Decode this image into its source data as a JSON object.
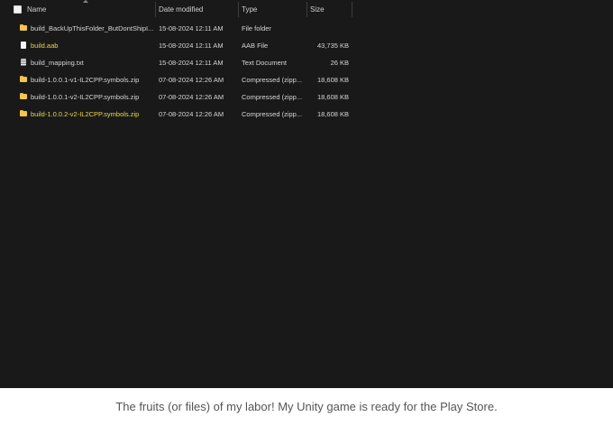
{
  "columns": {
    "name": "Name",
    "date_modified": "Date modified",
    "type": "Type",
    "size": "Size"
  },
  "files": [
    {
      "name": "build_BackUpThisFolder_ButDontShipI...",
      "date": "15-08-2024 12:11 AM",
      "type": "File folder",
      "size": "",
      "icon": "folder-icon",
      "highlight": false
    },
    {
      "name": "build.aab",
      "date": "15-08-2024 12:11 AM",
      "type": "AAB File",
      "size": "43,735 KB",
      "icon": "file-icon",
      "highlight": true
    },
    {
      "name": "build_mapping.txt",
      "date": "15-08-2024 12:11 AM",
      "type": "Text Document",
      "size": "26 KB",
      "icon": "text-document-icon",
      "highlight": false
    },
    {
      "name": "build-1.0.0.1-v1-IL2CPP.symbols.zip",
      "date": "07-08-2024 12:26 AM",
      "type": "Compressed (zipp...",
      "size": "18,608 KB",
      "icon": "zip-folder-icon",
      "highlight": false
    },
    {
      "name": "build-1.0.0.1-v2-IL2CPP.symbols.zip",
      "date": "07-08-2024 12:26 AM",
      "type": "Compressed (zipp...",
      "size": "18,608 KB",
      "icon": "zip-folder-icon",
      "highlight": false
    },
    {
      "name": "build-1.0.0.2-v2-IL2CPP.symbols.zip",
      "date": "07-08-2024 12:26 AM",
      "type": "Compressed (zipp...",
      "size": "18,608 KB",
      "icon": "zip-folder-icon",
      "highlight": true
    }
  ],
  "caption": "The fruits (or files) of my labor! My Unity game is ready for the Play Store.",
  "colors": {
    "background": "#191919",
    "text": "#d6d6d6",
    "highlight_text": "#e6d84a",
    "caption_text": "#555555"
  }
}
